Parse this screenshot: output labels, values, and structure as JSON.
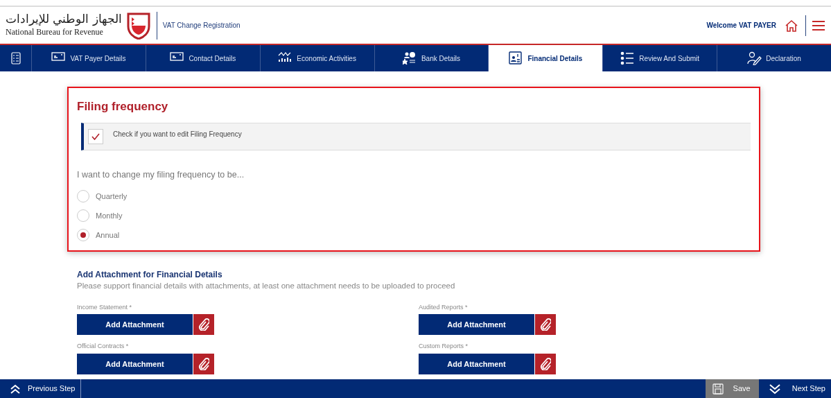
{
  "header": {
    "logo_arabic": "الجهاز الوطني للإيرادات",
    "logo_english": "National Bureau for Revenue",
    "page_title": "VAT Change Registration",
    "welcome": "Welcome VAT PAYER"
  },
  "steps": [
    {
      "label": "VAT Payer Details",
      "kind": "card",
      "selected": false
    },
    {
      "label": "Contact Details",
      "kind": "card",
      "selected": false
    },
    {
      "label": "Economic Activities",
      "kind": "chart",
      "selected": false
    },
    {
      "label": "Bank Details",
      "kind": "bank",
      "selected": false
    },
    {
      "label": "Financial Details",
      "kind": "finance",
      "selected": true
    },
    {
      "label": "Review And Submit",
      "kind": "list",
      "selected": false
    },
    {
      "label": "Declaration",
      "kind": "sign",
      "selected": false
    }
  ],
  "filing": {
    "title": "Filing frequency",
    "edit_checkbox": {
      "label": "Check if you want to edit Filing Frequency",
      "checked": true
    },
    "prompt": "I want to change my filing frequency to be...",
    "options": [
      {
        "label": "Quarterly",
        "selected": false
      },
      {
        "label": "Monthly",
        "selected": false
      },
      {
        "label": "Annual",
        "selected": true
      }
    ]
  },
  "attachments": {
    "title": "Add Attachment for Financial Details",
    "subtitle": "Please support financial details with attachments, at least one attachment needs to be uploaded to proceed",
    "fields": [
      {
        "label": "Income Statement",
        "required_mark": "*",
        "button": "Add Attachment"
      },
      {
        "label": "Audited Reports",
        "required_mark": "*",
        "button": "Add Attachment"
      },
      {
        "label": "Official Contracts",
        "required_mark": "*",
        "button": "Add Attachment"
      },
      {
        "label": "Custom Reports",
        "required_mark": "*",
        "button": "Add Attachment"
      }
    ]
  },
  "footer": {
    "previous": "Previous Step",
    "save": "Save",
    "next": "Next Step"
  }
}
